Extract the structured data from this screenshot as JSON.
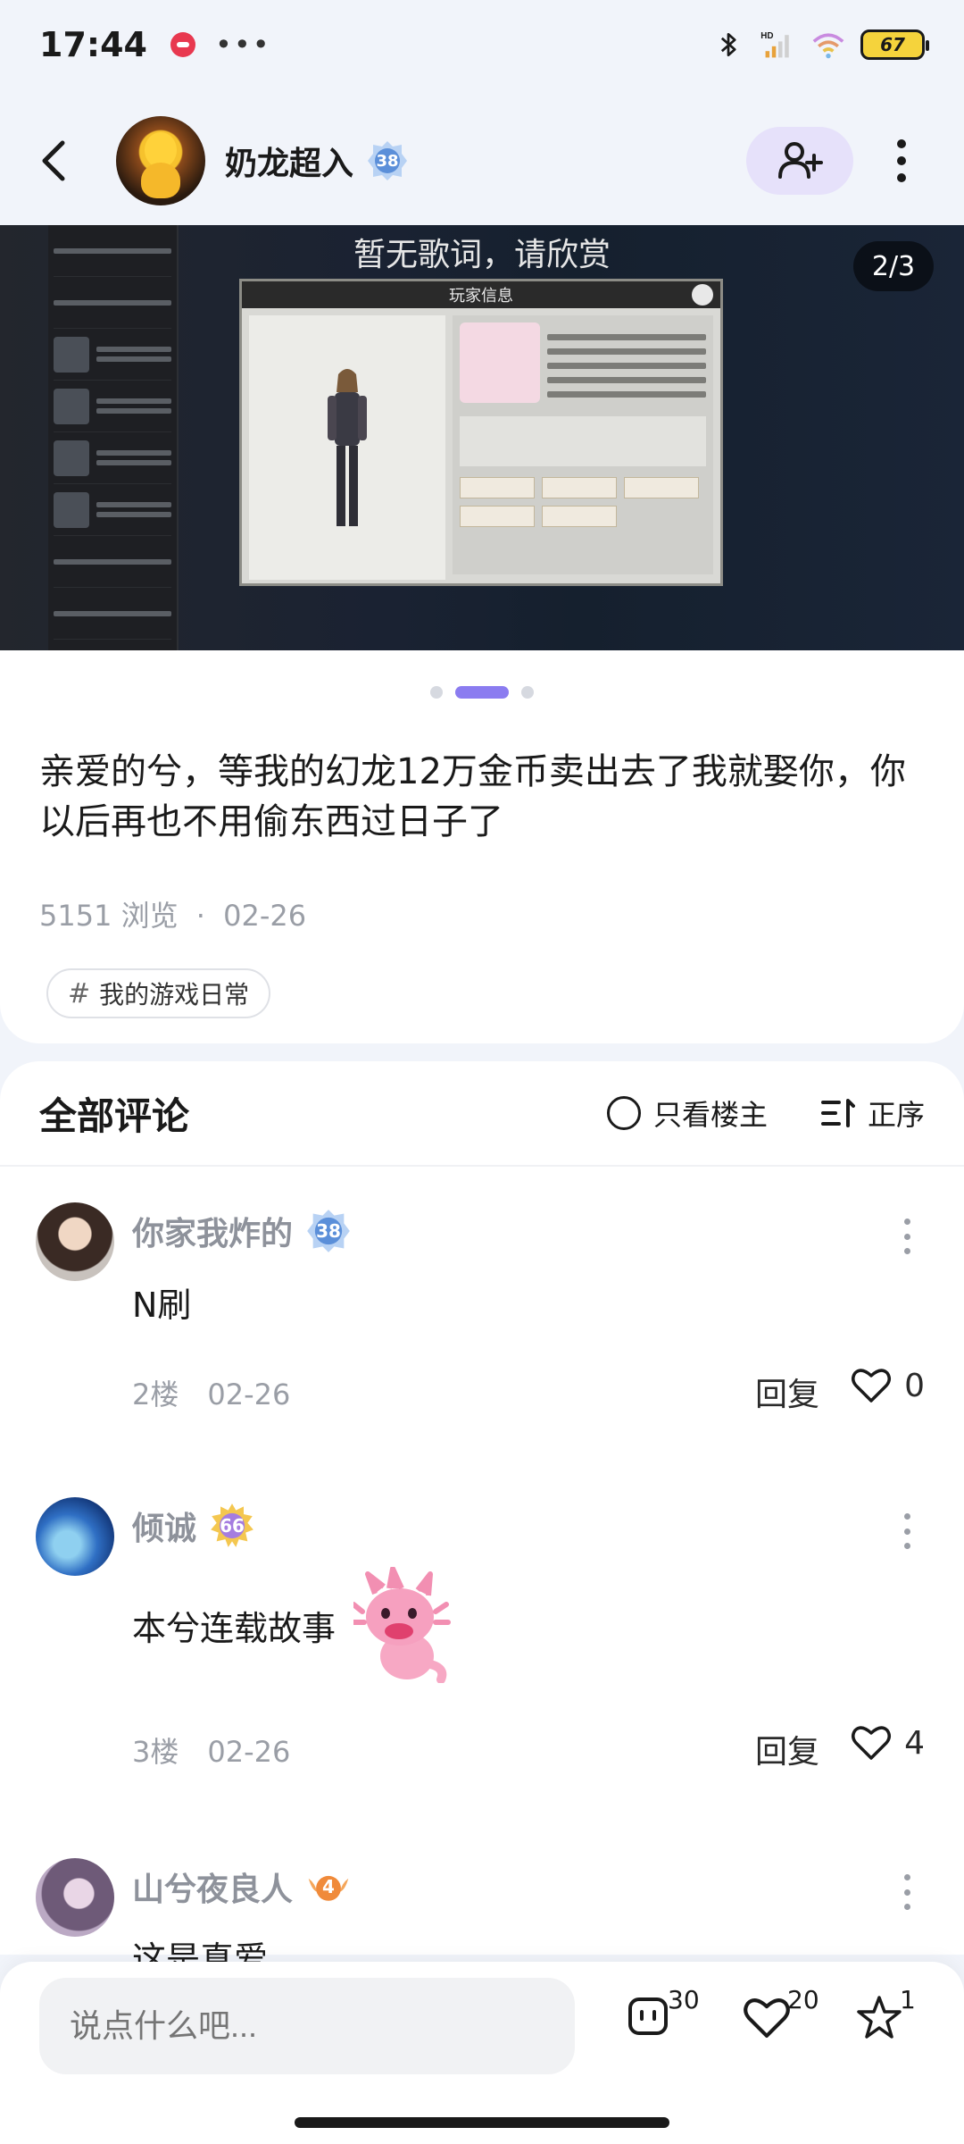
{
  "status_bar": {
    "time": "17:44",
    "more": "•••",
    "battery": "67"
  },
  "header": {
    "user_name": "奶龙超入",
    "level": "38"
  },
  "carousel": {
    "lyrics": "暂无歌词，请欣赏",
    "page_indicator": "2/3",
    "dialog_title": "玩家信息"
  },
  "post": {
    "text": "亲爱的兮，等我的幻龙12万金币卖出去了我就娶你，你以后再也不用偷东西过日子了",
    "views": "5151 浏览",
    "separator": "·",
    "date": "02-26",
    "tag": "我的游戏日常"
  },
  "comments_section": {
    "title": "全部评论",
    "only_host": "只看楼主",
    "sort": "正序"
  },
  "comments": [
    {
      "name": "你家我炸的",
      "level": "38",
      "text": "N刷",
      "floor": "2楼",
      "date": "02-26",
      "reply": "回复",
      "likes": "0"
    },
    {
      "name": "倾诚",
      "level": "66",
      "text": "本兮连载故事",
      "floor": "3楼",
      "date": "02-26",
      "reply": "回复",
      "likes": "4"
    },
    {
      "name": "山兮夜良人",
      "level": "4",
      "text": "这是真爱"
    }
  ],
  "bottom_bar": {
    "input_placeholder": "说点什么吧...",
    "comment_count": "30",
    "like_count": "20",
    "fav_count": "1"
  },
  "colors": {
    "accent": "#8b7cf0",
    "follow_bg": "#e6e1fa",
    "page_bg": "#f1f4fa"
  }
}
